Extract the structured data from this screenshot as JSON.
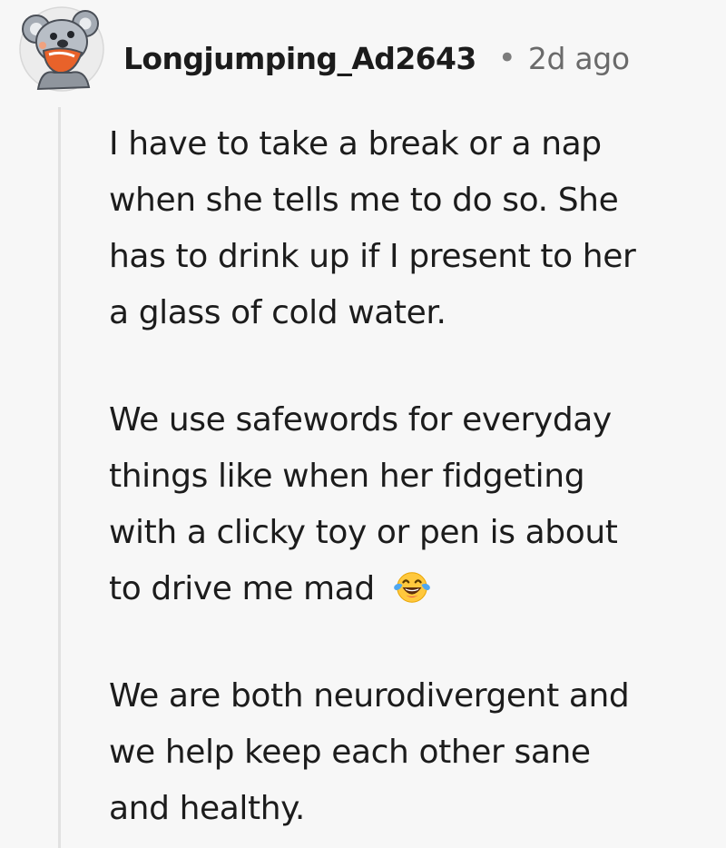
{
  "comment": {
    "author": "Longjumping_Ad2643",
    "separator": "•",
    "timestamp": "2d ago",
    "avatar_icon": "koala-avatar-icon",
    "paragraphs": [
      {
        "lines": [
          "I have to take a break or a nap",
          "when she tells me to do so. She",
          "has to drink up if I present to her",
          "a glass of cold water."
        ]
      },
      {
        "lines": [
          "We use safewords for everyday",
          "things like when her fidgeting",
          "with a clicky toy or pen is about",
          "to drive me mad"
        ],
        "emoji": "face-with-tears-of-joy-icon"
      },
      {
        "lines": [
          "We are both neurodivergent and",
          "we help keep each other sane",
          "and healthy."
        ]
      }
    ]
  },
  "colors": {
    "background": "#f7f7f7",
    "text": "#1c1c1c",
    "meta_text": "#6a6a6a",
    "thread_line": "#e2e2e2",
    "emoji_yellow": "#ffc83d",
    "avatar_gray": "#9aa1aa",
    "avatar_orange": "#e8622a"
  }
}
